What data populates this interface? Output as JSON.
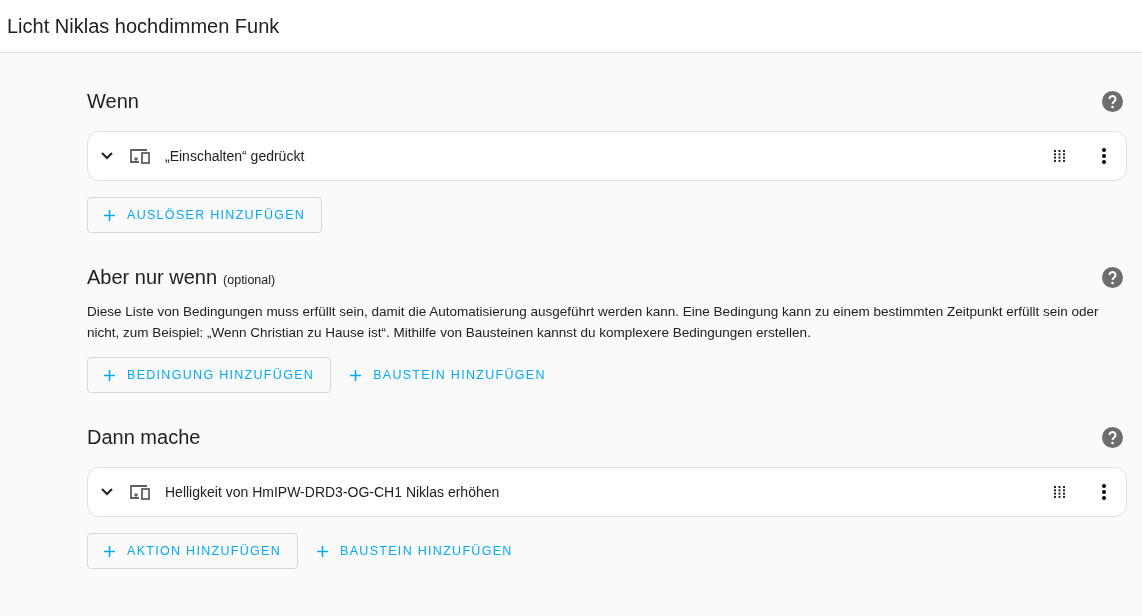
{
  "header": {
    "title": "Licht Niklas hochdimmen Funk"
  },
  "sections": [
    {
      "title": "Wenn",
      "rows": [
        {
          "label": "„Einschalten“ gedrückt"
        }
      ],
      "buttons": [
        {
          "label": "AUSLÖSER HINZUFÜGEN",
          "kind": "outlined"
        }
      ]
    },
    {
      "title": "Aber nur wenn",
      "note": "(optional)",
      "description": "Diese Liste von Bedingungen muss erfüllt sein, damit die Automatisierung ausgeführt werden kann. Eine Bedingung kann zu einem bestimmten Zeitpunkt erfüllt sein oder nicht, zum Beispiel: „Wenn Christian zu Hause ist“. Mithilfe von Bausteinen kannst du komplexere Bedingungen erstellen.",
      "buttons": [
        {
          "label": "BEDINGUNG HINZUFÜGEN",
          "kind": "outlined"
        },
        {
          "label": "BAUSTEIN HINZUFÜGEN",
          "kind": "text"
        }
      ]
    },
    {
      "title": "Dann mache",
      "rows": [
        {
          "label": "Helligkeit von HmIPW-DRD3-OG-CH1 Niklas erhöhen"
        }
      ],
      "buttons": [
        {
          "label": "AKTION HINZUFÜGEN",
          "kind": "outlined"
        },
        {
          "label": "BAUSTEIN HINZUFÜGEN",
          "kind": "text"
        }
      ]
    }
  ]
}
